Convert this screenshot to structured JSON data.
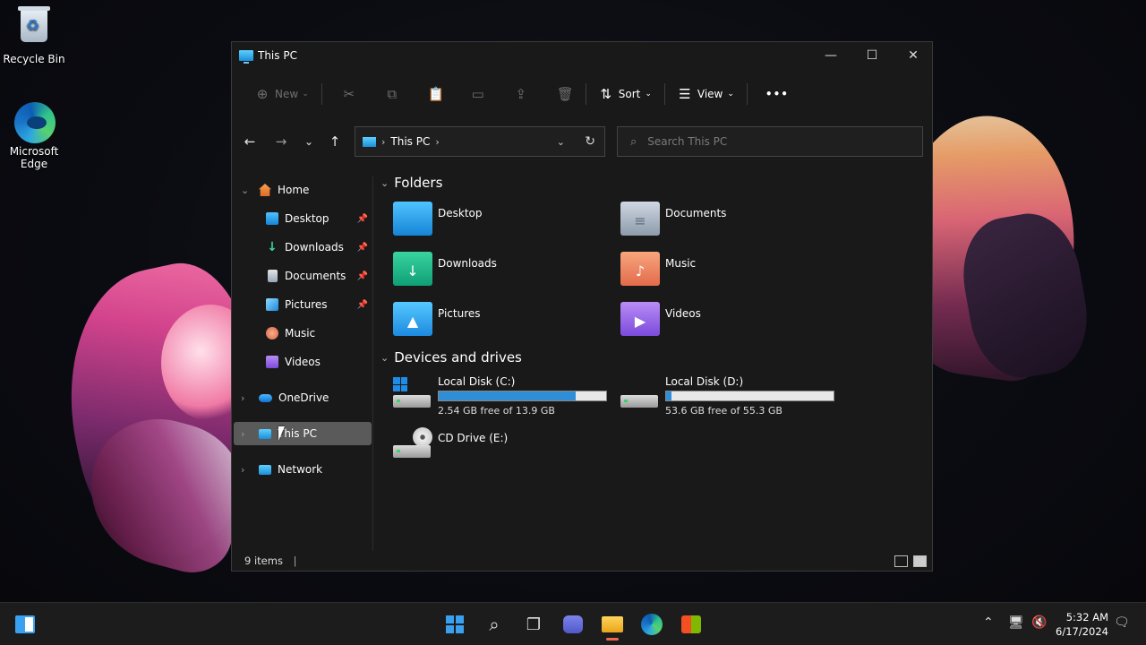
{
  "desktop": {
    "icons": [
      {
        "label": "Recycle Bin",
        "icon": "recycle-bin-icon"
      },
      {
        "label": "Microsoft Edge",
        "icon": "edge-icon"
      }
    ]
  },
  "window": {
    "title": "This PC",
    "controls": {
      "minimize": "—",
      "maximize": "☐",
      "close": "✕"
    }
  },
  "toolbar": {
    "new_label": "New",
    "sort_label": "Sort",
    "view_label": "View",
    "more_label": "•••"
  },
  "nav": {
    "back": "←",
    "forward": "→",
    "recent": "⌄",
    "up": "↑",
    "address": "This PC",
    "refresh": "↻",
    "search_placeholder": "Search This PC"
  },
  "sidebar": {
    "items": [
      {
        "label": "Home",
        "icon": "home-icon"
      },
      {
        "label": "Desktop",
        "icon": "desktop-folder-icon",
        "pinned": true
      },
      {
        "label": "Downloads",
        "icon": "downloads-icon",
        "pinned": true
      },
      {
        "label": "Documents",
        "icon": "documents-icon",
        "pinned": true
      },
      {
        "label": "Pictures",
        "icon": "pictures-icon",
        "pinned": true
      },
      {
        "label": "Music",
        "icon": "music-icon"
      },
      {
        "label": "Videos",
        "icon": "videos-icon"
      },
      {
        "label": "OneDrive",
        "icon": "onedrive-icon"
      },
      {
        "label": "This PC",
        "icon": "this-pc-icon",
        "selected": true
      },
      {
        "label": "Network",
        "icon": "network-icon"
      }
    ]
  },
  "main": {
    "folders_heading": "Folders",
    "folders": [
      {
        "label": "Desktop"
      },
      {
        "label": "Documents"
      },
      {
        "label": "Downloads"
      },
      {
        "label": "Music"
      },
      {
        "label": "Pictures"
      },
      {
        "label": "Videos"
      }
    ],
    "drives_heading": "Devices and drives",
    "drives": [
      {
        "label": "Local Disk (C:)",
        "free": "2.54 GB free of 13.9 GB",
        "used_fraction": 0.82
      },
      {
        "label": "Local Disk (D:)",
        "free": "53.6 GB free of 55.3 GB",
        "used_fraction": 0.03
      },
      {
        "label": "CD Drive (E:)"
      }
    ]
  },
  "status": {
    "items_count": "9 items"
  },
  "taskbar": {
    "time": "5:32 AM",
    "date": "6/17/2024",
    "accent": "#f06a4a"
  }
}
